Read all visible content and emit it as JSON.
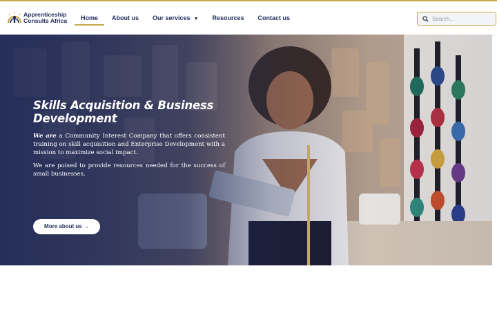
{
  "brand": {
    "name_line1": "Apprenticeship",
    "name_line2": "Consults Africa",
    "accent_color": "#c8a84a",
    "navy_color": "#1f2b5b"
  },
  "nav": {
    "items": [
      {
        "label": "Home",
        "active": true
      },
      {
        "label": "About us",
        "active": false
      },
      {
        "label": "Our services",
        "active": false,
        "has_dropdown": true
      },
      {
        "label": "Resources",
        "active": false
      },
      {
        "label": "Contact us",
        "active": false
      }
    ]
  },
  "search": {
    "placeholder": "Search...",
    "icon": "search-icon"
  },
  "hero": {
    "title_line1": "Skills Acquisition & Business",
    "title_line2": "Development",
    "p1_emph_we": "We",
    "p1_emph_are": "are",
    "p1_rest": "a Community Interest Company that offers consistent training on skill acquisition and Enterprise Development with a mission to maximize social impact.",
    "p2": "We are poised to provide resources needed for the success of small businesses.",
    "cta_label": "More about us",
    "cta_arrow": "→"
  }
}
